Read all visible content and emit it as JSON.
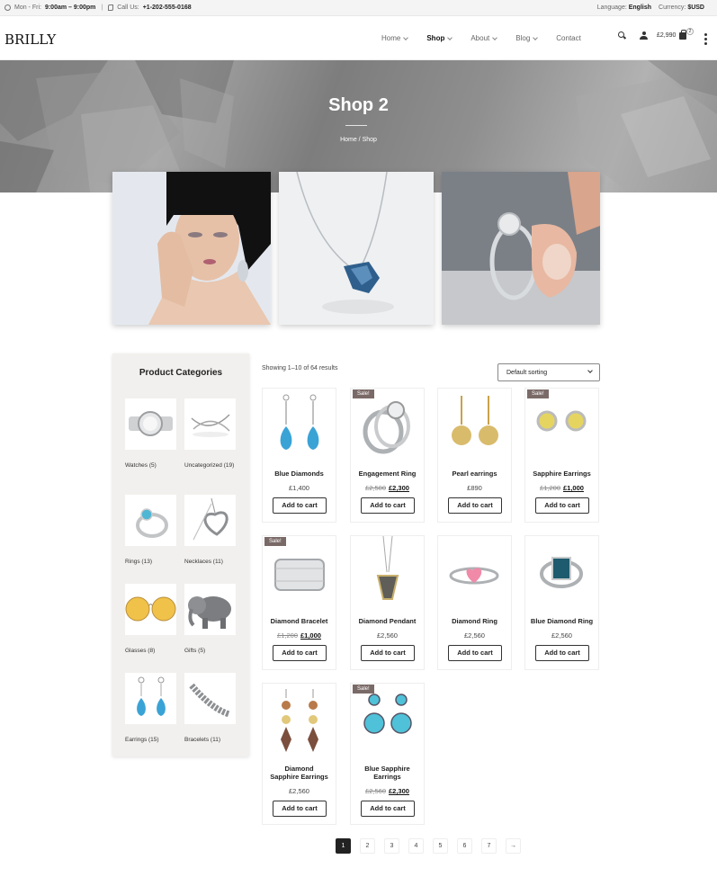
{
  "topbar": {
    "hours_prefix": "Mon - Fri:",
    "hours": "9:00am – 9:00pm",
    "call_prefix": "Call Us:",
    "phone": "+1-202-555-0168",
    "language_label": "Language:",
    "language": "English",
    "currency_label": "Currency:",
    "currency": "$USD"
  },
  "header": {
    "logo": "BRILLY",
    "nav": [
      {
        "label": "Home",
        "dropdown": true,
        "active": false
      },
      {
        "label": "Shop",
        "dropdown": true,
        "active": true
      },
      {
        "label": "About",
        "dropdown": true,
        "active": false
      },
      {
        "label": "Blog",
        "dropdown": true,
        "active": false
      },
      {
        "label": "Contact",
        "dropdown": false,
        "active": false
      }
    ],
    "cart_total": "£2,990",
    "cart_count": "2"
  },
  "hero": {
    "title": "Shop 2",
    "breadcrumb": "Home / Shop"
  },
  "sidebar": {
    "title": "Product Categories",
    "categories": [
      {
        "label": "Watches (5)",
        "icon": "watch"
      },
      {
        "label": "Uncategorized (19)",
        "icon": "ring-wire"
      },
      {
        "label": "Rings (13)",
        "icon": "ring"
      },
      {
        "label": "Necklaces (11)",
        "icon": "heart-necklace"
      },
      {
        "label": "Glasses (8)",
        "icon": "glasses"
      },
      {
        "label": "Gifts (5)",
        "icon": "elephant"
      },
      {
        "label": "Earrings (15)",
        "icon": "earrings"
      },
      {
        "label": "Bracelets (11)",
        "icon": "bracelet"
      }
    ]
  },
  "shop": {
    "result_count": "Showing 1–10 of 64 results",
    "sorting": "Default sorting",
    "sale_label": "Sale!",
    "add_to_cart": "Add to cart",
    "products": [
      {
        "name": "Blue Diamonds",
        "price": "£1,400",
        "old_price": null,
        "sale": false
      },
      {
        "name": "Engagement Ring",
        "price": "£2,300",
        "old_price": "£2,500",
        "sale": true
      },
      {
        "name": "Pearl earrings",
        "price": "£890",
        "old_price": null,
        "sale": false
      },
      {
        "name": "Sapphire Earrings",
        "price": "£1,000",
        "old_price": "£1,200",
        "sale": true
      },
      {
        "name": "Diamond Bracelet",
        "price": "£1,000",
        "old_price": "£1,200",
        "sale": true
      },
      {
        "name": "Diamond Pendant",
        "price": "£2,560",
        "old_price": null,
        "sale": false
      },
      {
        "name": "Diamond Ring",
        "price": "£2,560",
        "old_price": null,
        "sale": false
      },
      {
        "name": "Blue Diamond Ring",
        "price": "£2,560",
        "old_price": null,
        "sale": false
      },
      {
        "name": "Diamond Sapphire Earrings",
        "price": "£2,560",
        "old_price": null,
        "sale": false
      },
      {
        "name": "Blue Sapphire Earrings",
        "price": "£2,300",
        "old_price": "£2,560",
        "sale": true
      }
    ]
  },
  "pagination": {
    "pages": [
      "1",
      "2",
      "3",
      "4",
      "5",
      "6",
      "7"
    ],
    "current": "1",
    "next": "→"
  }
}
